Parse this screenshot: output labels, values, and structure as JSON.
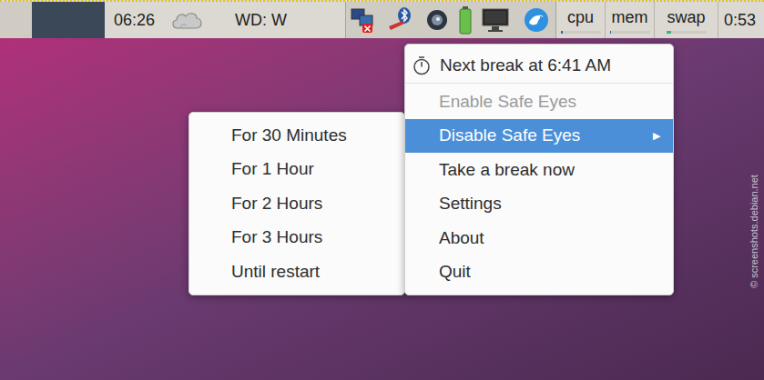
{
  "panel": {
    "clock": "06:26",
    "weather": "WD: W",
    "monitors": [
      {
        "label": "cpu",
        "level": 0.06,
        "color": "#2f5fb3"
      },
      {
        "label": "mem",
        "level": 0.04,
        "color": "#2f5fb3"
      },
      {
        "label": "swap",
        "level": 0.12,
        "color": "#3cb38a"
      }
    ],
    "uptime": "0:53"
  },
  "menu": {
    "header": "Next break at 6:41 AM",
    "submenu_arrow": "▶",
    "items": [
      {
        "label": "Enable Safe Eyes",
        "disabled": true,
        "selected": false,
        "submenu": false
      },
      {
        "label": "Disable Safe Eyes",
        "disabled": false,
        "selected": true,
        "submenu": true
      },
      {
        "label": "Take a break now",
        "disabled": false,
        "selected": false,
        "submenu": false
      },
      {
        "label": "Settings",
        "disabled": false,
        "selected": false,
        "submenu": false
      },
      {
        "label": "About",
        "disabled": false,
        "selected": false,
        "submenu": false
      },
      {
        "label": "Quit",
        "disabled": false,
        "selected": false,
        "submenu": false
      }
    ]
  },
  "submenu": {
    "items": [
      {
        "label": "For 30 Minutes",
        "selected": false
      },
      {
        "label": "For 1 Hour",
        "selected": false
      },
      {
        "label": "For 2 Hours",
        "selected": false
      },
      {
        "label": "For 3 Hours",
        "selected": false
      },
      {
        "label": "Until restart",
        "selected": false
      }
    ]
  },
  "watermark": "© screenshots.debian.net"
}
